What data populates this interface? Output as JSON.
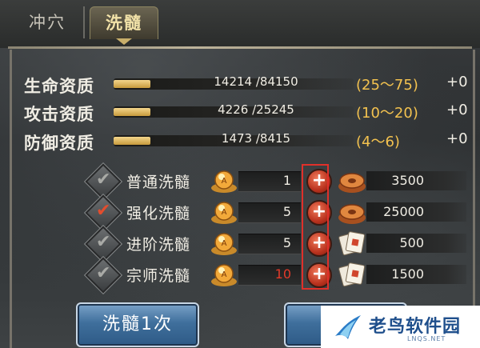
{
  "tabs": [
    {
      "label": "冲穴",
      "active": false
    },
    {
      "label": "洗髓",
      "active": true
    }
  ],
  "stats": [
    {
      "label": "生命资质",
      "current": 14214,
      "max": 84150,
      "value_text": "14214 /84150",
      "range": "(25～75)",
      "bonus": "+0"
    },
    {
      "label": "攻击资质",
      "current": 4226,
      "max": 25245,
      "value_text": "4226 /25245",
      "range": "(10～20)",
      "bonus": "+0"
    },
    {
      "label": "防御资质",
      "current": 1473,
      "max": 8415,
      "value_text": "1473 /8415",
      "range": "(4～6)",
      "bonus": "+0"
    }
  ],
  "options": [
    {
      "label": "普通洗髓",
      "checked": false,
      "qty": "1",
      "qty_red": false,
      "cost_icon": "copper-coin-icon",
      "cost": "3500"
    },
    {
      "label": "强化洗髓",
      "checked": true,
      "qty": "5",
      "qty_red": false,
      "cost_icon": "copper-coin-icon",
      "cost": "25000"
    },
    {
      "label": "进阶洗髓",
      "checked": false,
      "qty": "5",
      "qty_red": false,
      "cost_icon": "token-card-icon",
      "cost": "500"
    },
    {
      "label": "宗师洗髓",
      "checked": false,
      "qty": "10",
      "qty_red": true,
      "cost_icon": "token-card-icon",
      "cost": "1500"
    }
  ],
  "buttons": {
    "once": "洗髓1次",
    "ten": "洗"
  },
  "watermark": {
    "name": "老鸟软件园",
    "sub": "LNQS.NET"
  },
  "colors": {
    "accent_gold": "#f3c24f",
    "qty_warning": "#e33a2a",
    "button_blue": "#3f6f9c",
    "highlight_red": "#e0302a"
  }
}
